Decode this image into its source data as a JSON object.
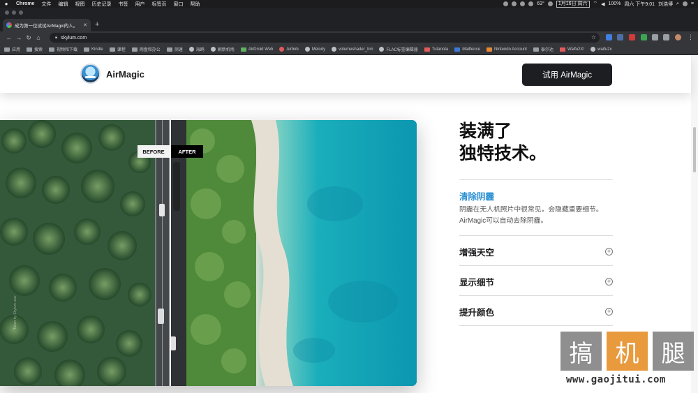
{
  "menubar": {
    "app": "Chrome",
    "items": [
      "文件",
      "编辑",
      "视图",
      "历史记录",
      "书签",
      "用户",
      "标签页",
      "窗口",
      "帮助"
    ],
    "temperature": "63°",
    "date": "1月16日 周六",
    "battery": "100%",
    "clock": "周六 下午9:01",
    "user": "刘浩博"
  },
  "browser": {
    "tab_title": "成为第一位试试AirMagic的人。",
    "url": "skylum.com",
    "bookmarks": [
      "应用",
      "搜索",
      "视频和下载",
      "Kindle",
      "课程",
      "网盘和办公",
      "测速",
      "海鸥",
      "刷新机场",
      "AirDroid Web",
      "Airbnb",
      "Melody",
      "volumeshader_bm",
      "FLAC标签编辑器",
      "Tutanota",
      "Mailfence",
      "Nintendo Account",
      "泰尔达",
      "Waifu2X!",
      "waifu2x"
    ]
  },
  "site": {
    "brand": "AirMagic",
    "cta": "试用 AirMagic"
  },
  "photo": {
    "before_label": "BEFORE",
    "after_label": "AFTER",
    "credit": "Taken by Skylum user"
  },
  "features": {
    "heading_line1": "装满了",
    "heading_line2": "独特技术。",
    "active_title": "清除阴霾",
    "active_desc": "阴霾在无人机照片中很常见，会隐藏重要细节。AirMagic可以自动去除阴霾。",
    "items": [
      "增强天空",
      "显示细节",
      "提升颜色"
    ]
  },
  "watermark": {
    "chars": [
      "搞",
      "机",
      "腿"
    ],
    "url": "www.gaojitui.com"
  },
  "colors": {
    "accent": "#2a8fd4",
    "cta_bg": "#1c1e22",
    "watermark_orange": "#e89a3d"
  }
}
